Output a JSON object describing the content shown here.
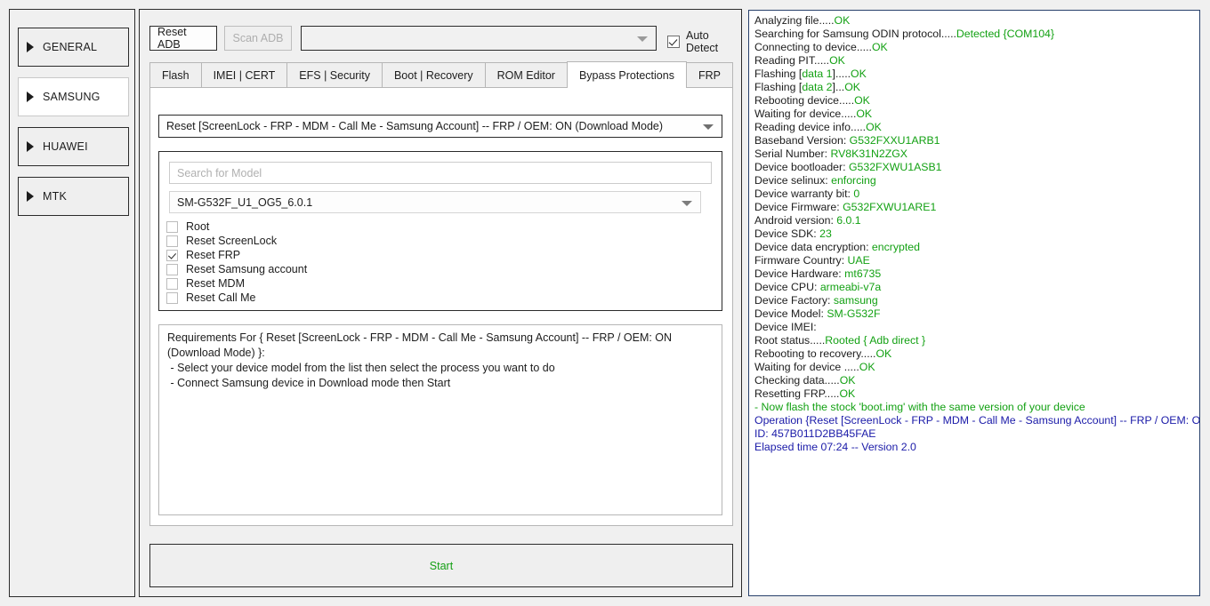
{
  "sidebar": {
    "items": [
      {
        "label": "GENERAL",
        "active": false
      },
      {
        "label": "SAMSUNG",
        "active": true
      },
      {
        "label": "HUAWEI",
        "active": false
      },
      {
        "label": "MTK",
        "active": false
      }
    ]
  },
  "toolbar": {
    "reset_adb_label": "Reset ADB",
    "scan_adb_label": "Scan ADB",
    "adb_port_value": "",
    "auto_detect_label": "Auto Detect",
    "auto_detect_checked": true
  },
  "tabs": [
    {
      "label": "Flash",
      "active": false
    },
    {
      "label": "IMEI | CERT",
      "active": false
    },
    {
      "label": "EFS | Security",
      "active": false
    },
    {
      "label": "Boot | Recovery",
      "active": false
    },
    {
      "label": "ROM Editor",
      "active": false
    },
    {
      "label": "Bypass Protections",
      "active": true
    },
    {
      "label": "FRP",
      "active": false
    }
  ],
  "operation": {
    "selected": "Reset [ScreenLock - FRP - MDM - Call Me - Samsung Account] -- FRP / OEM: ON (Download Mode)"
  },
  "model": {
    "search_placeholder": "Search for Model",
    "search_value": "",
    "selected": "SM-G532F_U1_OG5_6.0.1",
    "options": [
      {
        "label": "Root",
        "checked": false
      },
      {
        "label": "Reset ScreenLock",
        "checked": false
      },
      {
        "label": "Reset FRP",
        "checked": true
      },
      {
        "label": "Reset Samsung account",
        "checked": false
      },
      {
        "label": "Reset MDM",
        "checked": false
      },
      {
        "label": "Reset Call Me",
        "checked": false
      }
    ]
  },
  "requirements": {
    "line1": "Requirements For { Reset [ScreenLock - FRP - MDM - Call Me - Samsung Account] -- FRP / OEM: ON (Download Mode) }:",
    "line2": " - Select your device model from the list then select the process you want to do",
    "line3": " - Connect Samsung device in Download mode then Start"
  },
  "start_button": {
    "label": "Start",
    "color": "#15a015"
  },
  "log": {
    "colors": {
      "green": "#13a113",
      "blue": "#1a1aa8",
      "black": "#1d1d1d"
    },
    "lines": [
      [
        {
          "t": "Analyzing file.....",
          "c": "black"
        },
        {
          "t": "OK",
          "c": "green"
        }
      ],
      [
        {
          "t": "Searching for Samsung ODIN protocol.....",
          "c": "black"
        },
        {
          "t": "Detected {COM104}",
          "c": "green"
        }
      ],
      [
        {
          "t": "Connecting to device.....",
          "c": "black"
        },
        {
          "t": "OK",
          "c": "green"
        }
      ],
      [
        {
          "t": "Reading PIT.....",
          "c": "black"
        },
        {
          "t": "OK",
          "c": "green"
        }
      ],
      [
        {
          "t": "Flashing [",
          "c": "black"
        },
        {
          "t": "data 1",
          "c": "green"
        },
        {
          "t": "].....",
          "c": "black"
        },
        {
          "t": "OK",
          "c": "green"
        }
      ],
      [
        {
          "t": "Flashing [",
          "c": "black"
        },
        {
          "t": "data 2",
          "c": "green"
        },
        {
          "t": "]...",
          "c": "black"
        },
        {
          "t": "OK",
          "c": "green"
        }
      ],
      [
        {
          "t": "Rebooting device.....",
          "c": "black"
        },
        {
          "t": "OK",
          "c": "green"
        }
      ],
      [
        {
          "t": "Waiting for device.....",
          "c": "black"
        },
        {
          "t": "OK",
          "c": "green"
        }
      ],
      [
        {
          "t": "Reading device info.....",
          "c": "black"
        },
        {
          "t": "OK",
          "c": "green"
        }
      ],
      [
        {
          "t": "Baseband Version: ",
          "c": "black"
        },
        {
          "t": "G532FXXU1ARB1",
          "c": "green"
        }
      ],
      [
        {
          "t": "Serial Number: ",
          "c": "black"
        },
        {
          "t": "RV8K31N2ZGX",
          "c": "green"
        }
      ],
      [
        {
          "t": "Device bootloader: ",
          "c": "black"
        },
        {
          "t": "G532FXWU1ASB1",
          "c": "green"
        }
      ],
      [
        {
          "t": "Device selinux: ",
          "c": "black"
        },
        {
          "t": "enforcing",
          "c": "green"
        }
      ],
      [
        {
          "t": "Device warranty bit: ",
          "c": "black"
        },
        {
          "t": "0",
          "c": "green"
        }
      ],
      [
        {
          "t": "Device Firmware: ",
          "c": "black"
        },
        {
          "t": "G532FXWU1ARE1",
          "c": "green"
        }
      ],
      [
        {
          "t": "Android version: ",
          "c": "black"
        },
        {
          "t": "6.0.1",
          "c": "green"
        }
      ],
      [
        {
          "t": "Device SDK: ",
          "c": "black"
        },
        {
          "t": "23",
          "c": "green"
        }
      ],
      [
        {
          "t": "Device data encryption: ",
          "c": "black"
        },
        {
          "t": "encrypted",
          "c": "green"
        }
      ],
      [
        {
          "t": "Firmware Country: ",
          "c": "black"
        },
        {
          "t": "UAE",
          "c": "green"
        }
      ],
      [
        {
          "t": "Device Hardware: ",
          "c": "black"
        },
        {
          "t": "mt6735",
          "c": "green"
        }
      ],
      [
        {
          "t": "Device CPU: ",
          "c": "black"
        },
        {
          "t": "armeabi-v7a",
          "c": "green"
        }
      ],
      [
        {
          "t": "Device Factory: ",
          "c": "black"
        },
        {
          "t": "samsung",
          "c": "green"
        }
      ],
      [
        {
          "t": "Device Model: ",
          "c": "black"
        },
        {
          "t": "SM-G532F",
          "c": "green"
        }
      ],
      [
        {
          "t": "Device IMEI:",
          "c": "black"
        }
      ],
      [
        {
          "t": "Root status.....",
          "c": "black"
        },
        {
          "t": "Rooted { Adb direct }",
          "c": "green"
        }
      ],
      [
        {
          "t": "Rebooting to recovery.....",
          "c": "black"
        },
        {
          "t": "OK",
          "c": "green"
        }
      ],
      [
        {
          "t": "Waiting for device .....",
          "c": "black"
        },
        {
          "t": "OK",
          "c": "green"
        }
      ],
      [
        {
          "t": "Checking data.....",
          "c": "black"
        },
        {
          "t": "OK",
          "c": "green"
        }
      ],
      [
        {
          "t": "Resetting FRP.....",
          "c": "black"
        },
        {
          "t": "OK",
          "c": "green"
        }
      ],
      [
        {
          "t": "- Now flash the stock 'boot.img' with the same version of your device",
          "c": "green"
        }
      ],
      [
        {
          "t": "Operation {Reset [ScreenLock - FRP - MDM - Call Me - Samsung Account] -- FRP / OEM: ON}",
          "c": "blue"
        }
      ],
      [
        {
          "t": "ID: 457B011D2BB45FAE",
          "c": "blue"
        }
      ],
      [
        {
          "t": "Elapsed time 07:24 -- Version 2.0",
          "c": "blue"
        }
      ]
    ]
  }
}
